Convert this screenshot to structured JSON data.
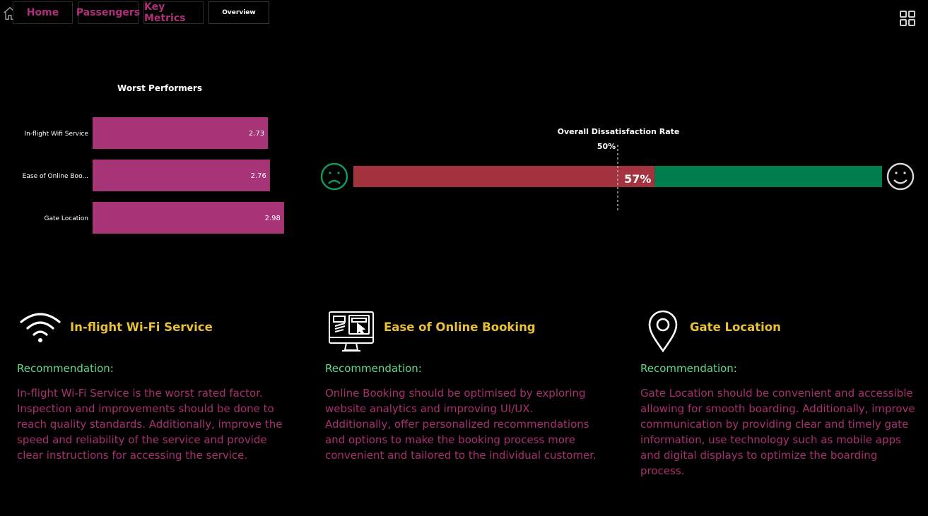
{
  "nav": {
    "buttons": [
      {
        "label": "Home"
      },
      {
        "label": "Passengers"
      },
      {
        "label": "Key Metrics"
      },
      {
        "label": "Overview"
      }
    ]
  },
  "icons": {
    "home": "home-icon",
    "grid": "grid-icon",
    "sad": "sad-face-icon",
    "happy": "happy-face-icon",
    "wifi": "wifi-icon",
    "booking": "online-booking-icon",
    "location": "location-pin-icon"
  },
  "colors": {
    "accent": "#b0307a",
    "bar": "#a83478",
    "dissatisfied": "#a3343f",
    "satisfied": "#007e4e",
    "heading": "#e9c135",
    "label": "#5edb8e",
    "body_text": "#a8306f"
  },
  "chart_data": {
    "type": "bar",
    "orientation": "horizontal",
    "title": "Worst Performers",
    "categories": [
      "In-flight Wifi Service",
      "Ease of Online Boo...",
      "Gate Location"
    ],
    "values": [
      2.73,
      2.76,
      2.98
    ],
    "value_labels": [
      "2.73",
      "2.76",
      "2.98"
    ],
    "xlim": [
      0,
      3.3
    ]
  },
  "gauge": {
    "title": "Overall Dissatisfaction Rate",
    "target_label": "50%",
    "target": 0.5,
    "value_label": "57%",
    "value": 0.57
  },
  "recommendations": [
    {
      "title": "In-flight Wi-Fi Service",
      "label": "Recommendation:",
      "text": "In-flight Wi-Fi Service is the worst rated factor. Inspection and improvements should be done to reach quality standards. Additionally, improve the speed and reliability of the service and provide clear instructions for accessing the service."
    },
    {
      "title": "Ease of Online Booking",
      "label": "Recommendation:",
      "text": "Online Booking should be optimised by exploring website analytics and improving UI/UX. Additionally, offer personalized recommendations and options to make the booking process more convenient and tailored to the individual customer."
    },
    {
      "title": "Gate Location",
      "label": "Recommendation:",
      "text": "Gate Location should be convenient and accessible allowing for smooth boarding. Additionally, improve communication by providing clear and timely gate information, use technology such as mobile apps and digital displays to optimize the boarding process."
    }
  ]
}
